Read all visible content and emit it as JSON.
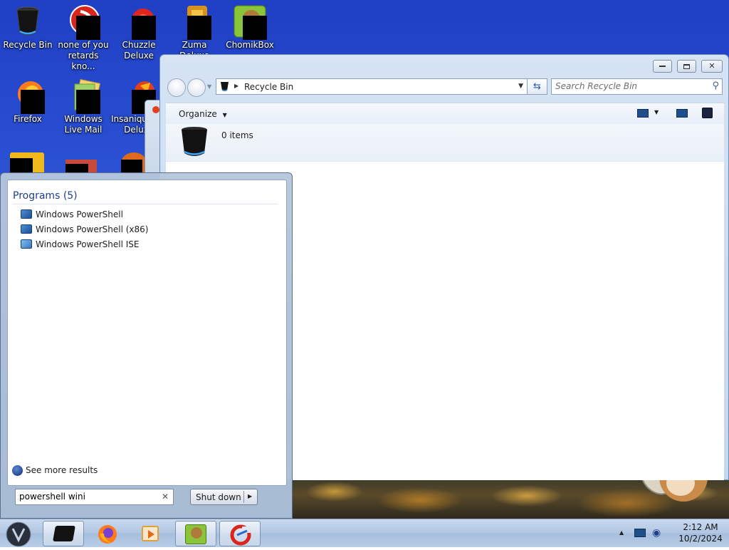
{
  "desktop": {
    "icons": [
      {
        "label": "Recycle Bin"
      },
      {
        "label": "none of you retards kno..."
      },
      {
        "label": "Chuzzle Deluxe"
      },
      {
        "label": "Zuma Deluxe"
      },
      {
        "label": "ChomikBox"
      },
      {
        "label": "Firefox"
      },
      {
        "label": "Windows Live Mail"
      },
      {
        "label": "Insaniquarium Deluxe"
      }
    ]
  },
  "explorer": {
    "address": {
      "location": "Recycle Bin"
    },
    "search": {
      "placeholder": "Search Recycle Bin"
    },
    "toolbar": {
      "organize_label": "Organize"
    },
    "details": {
      "item_count": "0 items"
    }
  },
  "start_menu": {
    "programs_header": "Programs (5)",
    "programs": [
      {
        "label": "Windows PowerShell"
      },
      {
        "label": "Windows PowerShell (x86)"
      },
      {
        "label": "Windows PowerShell ISE"
      }
    ],
    "see_more_label": "See more results",
    "search": {
      "value": "powershell wini"
    },
    "shutdown_label": "Shut down"
  },
  "taskbar": {
    "clock": {
      "time": "2:12 AM",
      "date": "10/2/2024"
    }
  },
  "colors": {
    "accent": "#1e5aa8",
    "programs_header": "#1e3f8a"
  }
}
